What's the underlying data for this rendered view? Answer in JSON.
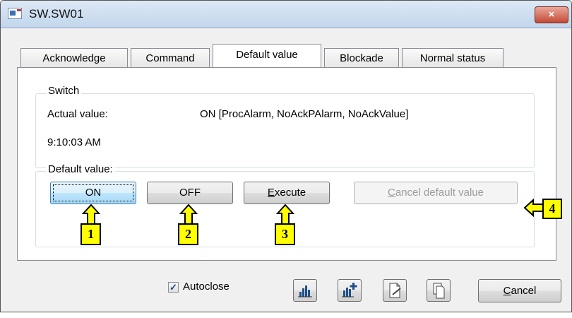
{
  "window": {
    "title": "SW.SW01",
    "close_label": "×"
  },
  "tabs": [
    {
      "label": "Acknowledge",
      "active": false
    },
    {
      "label": "Command",
      "active": false
    },
    {
      "label": "Default value",
      "active": true
    },
    {
      "label": "Blockade",
      "active": false
    },
    {
      "label": "Normal status",
      "active": false
    }
  ],
  "switch_group": {
    "label": "Switch",
    "actual_value_label": "Actual value:",
    "actual_value": "ON [ProcAlarm, NoAckPAlarm, NoAckValue]",
    "timestamp": "9:10:03 AM"
  },
  "default_group": {
    "label": "Default value:",
    "on_button": "ON",
    "off_button": "OFF",
    "execute_button": {
      "mnemonic": "E",
      "rest": "xecute"
    },
    "cancel_default_button": {
      "mnemonic": "C",
      "rest": "ancel default value"
    }
  },
  "callouts": [
    "1",
    "2",
    "3",
    "4"
  ],
  "footer": {
    "autoclose_label": "Autoclose",
    "autoclose_checked": true,
    "check_mark": "✓",
    "icon_buttons": [
      "chart-icon",
      "chart-add-icon",
      "edit-document-icon",
      "copy-document-icon"
    ],
    "cancel_button": {
      "mnemonic": "C",
      "rest": "ancel"
    }
  },
  "colors": {
    "callout_fill": "#ffff00",
    "close_button": "#c44a34",
    "focus_button": "#bee6fd"
  }
}
